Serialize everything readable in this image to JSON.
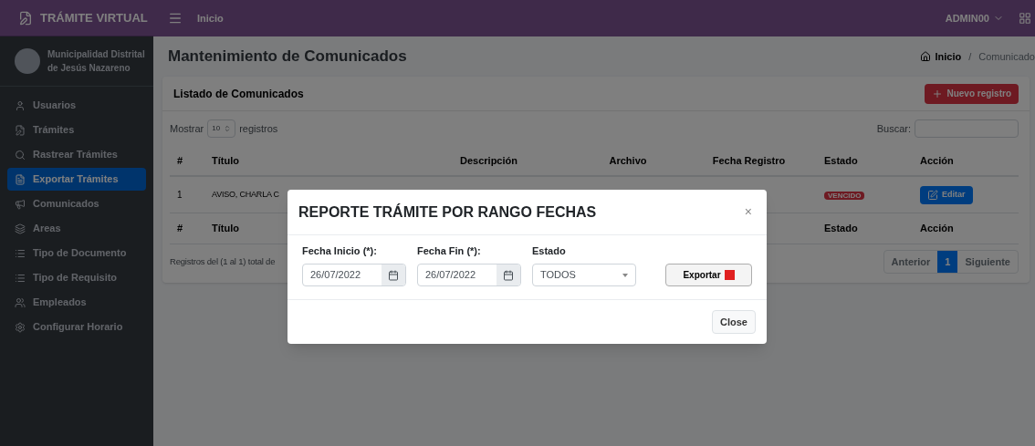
{
  "brand": {
    "title": "TRÁMITE VIRTUAL"
  },
  "topbar": {
    "link": "Inicio",
    "user": "ADMIN00"
  },
  "sidebar": {
    "org_lines": [
      "Municipalidad Distrital",
      "de Jesús Nazareno"
    ],
    "items": [
      {
        "label": "Usuarios",
        "selected": false
      },
      {
        "label": "Trámites",
        "selected": false
      },
      {
        "label": "Rastrear Trámites",
        "selected": false
      },
      {
        "label": "Exportar Trámites",
        "selected": true
      },
      {
        "label": "Comunicados",
        "selected": false
      },
      {
        "label": "Areas",
        "selected": false
      },
      {
        "label": "Tipo de Documento",
        "selected": false
      },
      {
        "label": "Tipo de Requisito",
        "selected": false
      },
      {
        "label": "Empleados",
        "selected": false
      },
      {
        "label": "Configurar Horario",
        "selected": false
      }
    ]
  },
  "page": {
    "title": "Mantenimiento de Comunicados",
    "breadcrumb": {
      "home": "Inicio",
      "separator": "/",
      "current": "Comunicado"
    }
  },
  "card": {
    "title": "Listado de Comunicados",
    "new_button": "Nuevo registro",
    "length": {
      "before": "Mostrar",
      "value": "10",
      "after": "registros"
    },
    "search_label": "Buscar:",
    "columns": [
      "#",
      "Título",
      "Descripción",
      "Archivo",
      "Fecha Registro",
      "Estado",
      "Acción"
    ],
    "row": {
      "number": "1",
      "title": "AVISO, CHARLA C",
      "status": "VENCIDO",
      "action": "Editar"
    },
    "footer_columns": [
      "#",
      "Título",
      "Estado",
      "Acción"
    ],
    "info": "Registros del (1 al 1) total de",
    "pagination": [
      {
        "label": "Anterior",
        "selected": false
      },
      {
        "label": "1",
        "selected": true
      },
      {
        "label": "Siguiente",
        "selected": false
      }
    ]
  },
  "modal": {
    "title": "REPORTE TRÁMITE POR RANGO FECHAS",
    "close": "×",
    "fields": [
      {
        "kind": "date",
        "label": "Fecha Inicio (*):",
        "value": "26/07/2022"
      },
      {
        "kind": "date",
        "label": "Fecha Fin (*):",
        "value": "26/07/2022"
      },
      {
        "kind": "select",
        "label": "Estado",
        "value": "TODOS"
      }
    ],
    "export_button": "Exportar",
    "close_button": "Close"
  }
}
